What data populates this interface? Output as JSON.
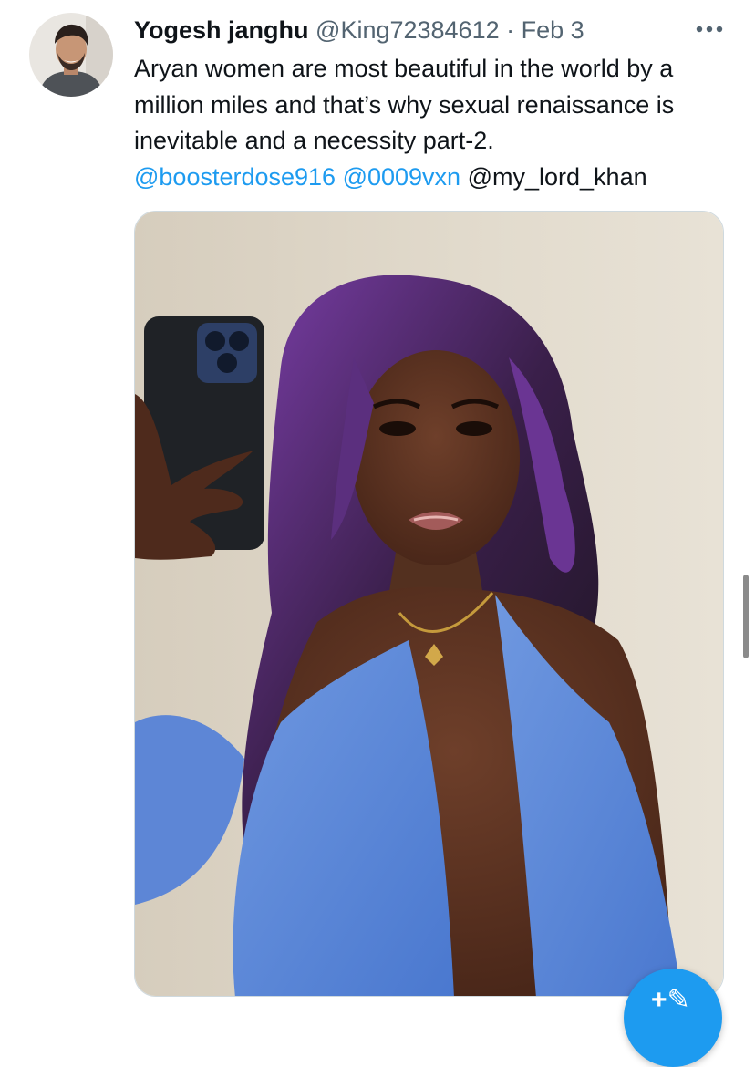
{
  "tweet": {
    "author_name": "Yogesh janghu",
    "author_handle": "@King72384612",
    "separator": "·",
    "date": "Feb 3",
    "text_line1": "Aryan women are most beautiful in the world by a",
    "text_line2": "million miles and that’s why sexual renaissance is",
    "text_line3": "inevitable and a necessity part-2.",
    "mentions": [
      "@boosterdose916",
      "@0009vxn",
      "@my_lord_khan"
    ]
  },
  "icons": {
    "more": "more-horizontal-icon",
    "compose": "compose-tweet-icon"
  },
  "colors": {
    "link": "#1d9bf0",
    "secondary_text": "#536471",
    "primary_text": "#0f1419",
    "fab": "#1d9bf0"
  }
}
